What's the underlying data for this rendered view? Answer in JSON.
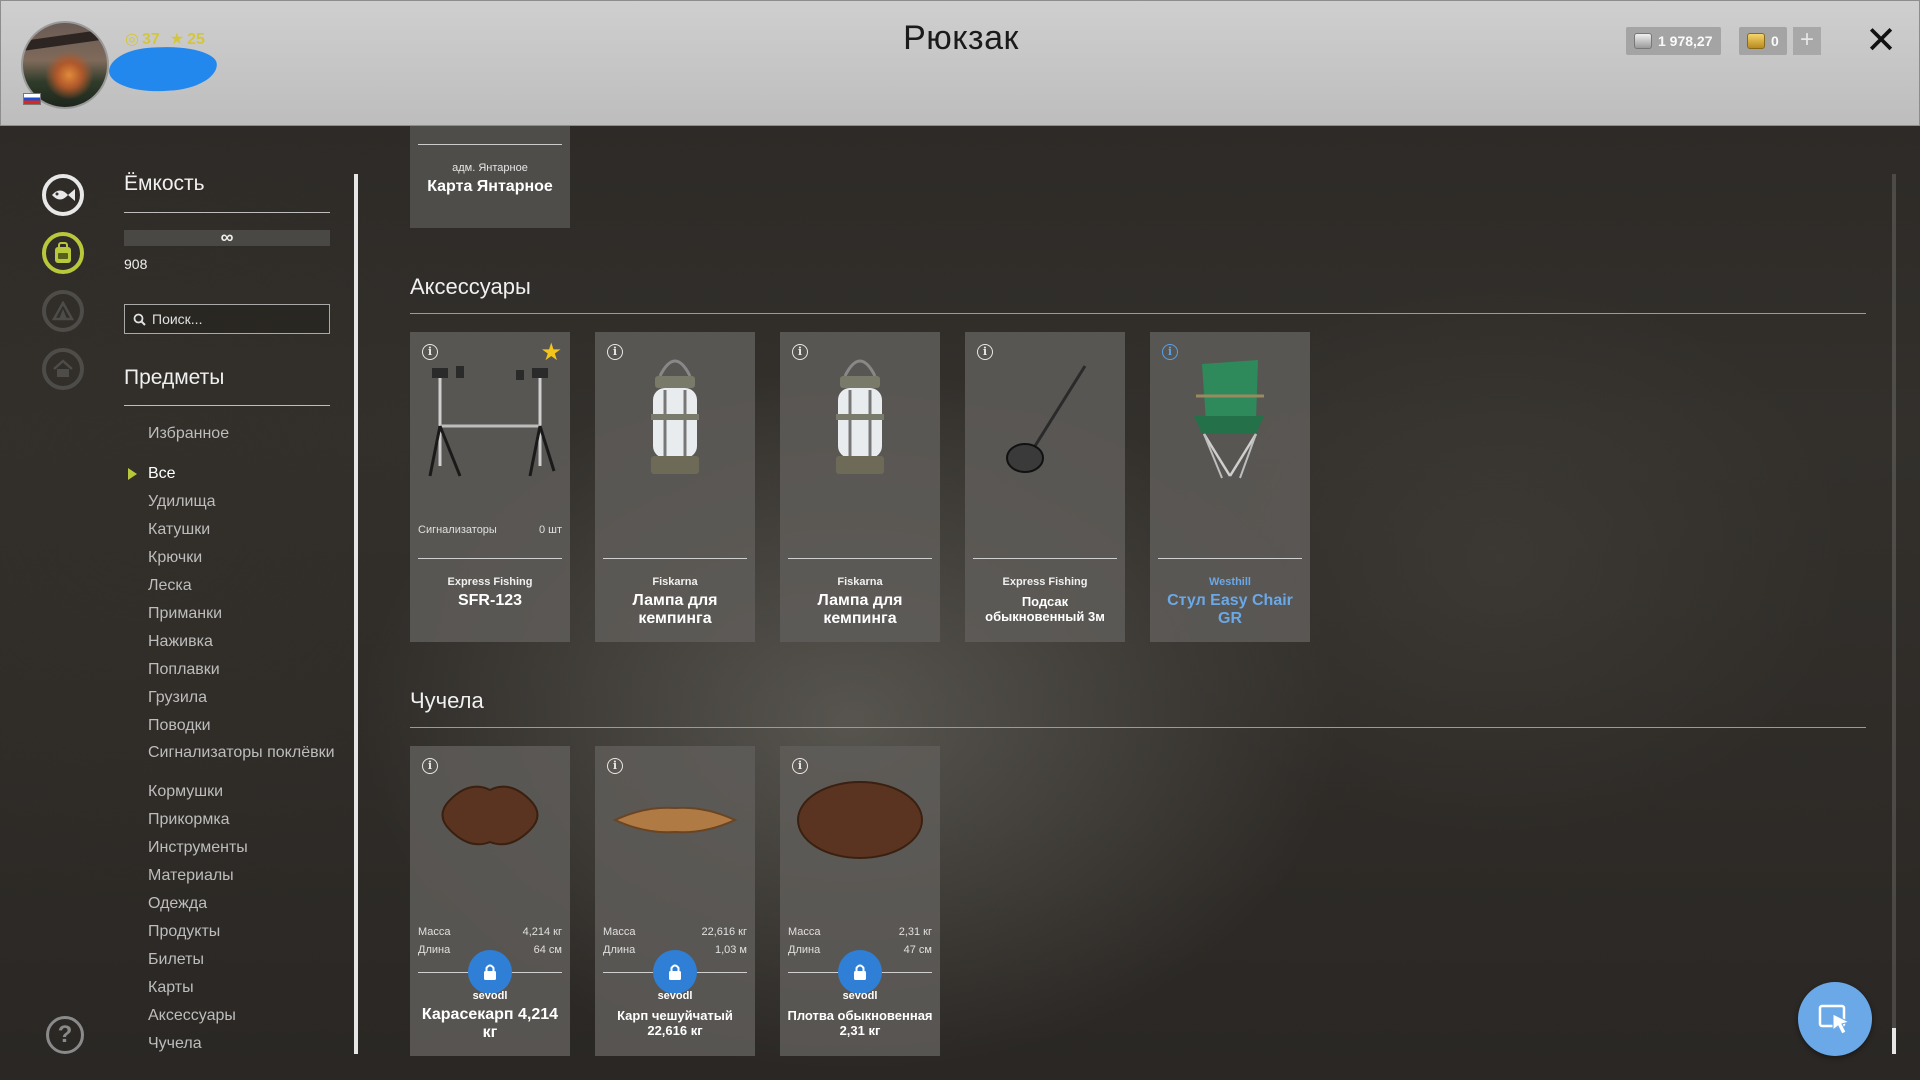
{
  "header": {
    "title": "Рюкзак",
    "level": "37",
    "stars": "25",
    "silver": "1 978,27",
    "gold": "0",
    "plus_label": "+",
    "close_label": "✕"
  },
  "sidebar": {
    "capacity_title": "Ёмкость",
    "capacity_symbol": "∞",
    "capacity_count": "908",
    "search_placeholder": "Поиск...",
    "items_title": "Предметы",
    "categories": [
      "Избранное",
      "Все",
      "Удилища",
      "Катушки",
      "Крючки",
      "Леска",
      "Приманки",
      "Наживка",
      "Поплавки",
      "Грузила",
      "Поводки",
      "Сигнализаторы поклёвки",
      "Кормушки",
      "Прикормка",
      "Инструменты",
      "Материалы",
      "Одежда",
      "Продукты",
      "Билеты",
      "Карты",
      "Аксессуары",
      "Чучела"
    ],
    "active_category": "Все",
    "help_label": "?"
  },
  "map_card": {
    "brand": "адм. Янтарное",
    "name": "Карта Янтарное"
  },
  "sections": {
    "accessories": "Аксессуары",
    "trophies": "Чучела"
  },
  "accessories": [
    {
      "brand": "Express Fishing",
      "name": "SFR-123",
      "meta_label": "Сигнализаторы",
      "meta_value": "0 шт",
      "favorite": true
    },
    {
      "brand": "Fiskarna",
      "name": "Лампа для кемпинга"
    },
    {
      "brand": "Fiskarna",
      "name": "Лампа для кемпинга"
    },
    {
      "brand": "Express Fishing",
      "name": "Подсак обыкновенный 3м"
    },
    {
      "brand": "Westhill",
      "name": "Стул Easy Chair GR",
      "highlight_color": "#6aa8e8"
    }
  ],
  "trophies": [
    {
      "mass_label": "Масса",
      "mass": "4,214 кг",
      "length_label": "Длина",
      "length": "64 см",
      "owner": "sevodl",
      "name": "Карасекарп 4,214 кг"
    },
    {
      "mass_label": "Масса",
      "mass": "22,616 кг",
      "length_label": "Длина",
      "length": "1,03 м",
      "owner": "sevodl",
      "name": "Карп чешуйчатый 22,616 кг"
    },
    {
      "mass_label": "Масса",
      "mass": "2,31 кг",
      "length_label": "Длина",
      "length": "47 см",
      "owner": "sevodl",
      "name": "Плотва обыкновенная 2,31 кг"
    }
  ],
  "info_symbol": "i",
  "colors": {
    "accent_green": "#b9c83a",
    "accent_blue": "#2f7fd6",
    "star": "#f2c51d"
  }
}
